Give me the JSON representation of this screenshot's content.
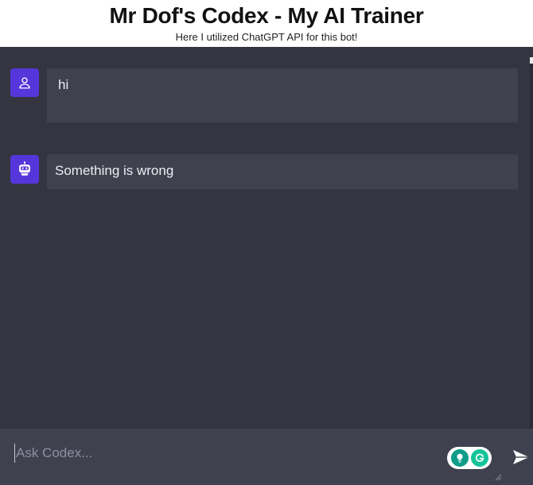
{
  "header": {
    "title": "Mr Dof's Codex - My AI Trainer",
    "subtitle": "Here I utilized ChatGPT API for this bot!"
  },
  "messages": [
    {
      "role": "user",
      "avatar_icon": "user-icon",
      "text": "hi"
    },
    {
      "role": "bot",
      "avatar_icon": "bot-icon",
      "text": "Something is wrong"
    }
  ],
  "input": {
    "placeholder": "Ask Codex...",
    "value": ""
  },
  "icons": {
    "send": "send-icon",
    "grammarly_suggestion": "lightbulb-icon",
    "grammarly_logo": "grammarly-g-icon"
  },
  "colors": {
    "background": "#343541",
    "bubble": "#40414f",
    "avatar": "#5436da",
    "header": "#ffffff",
    "text": "#ececf1"
  }
}
